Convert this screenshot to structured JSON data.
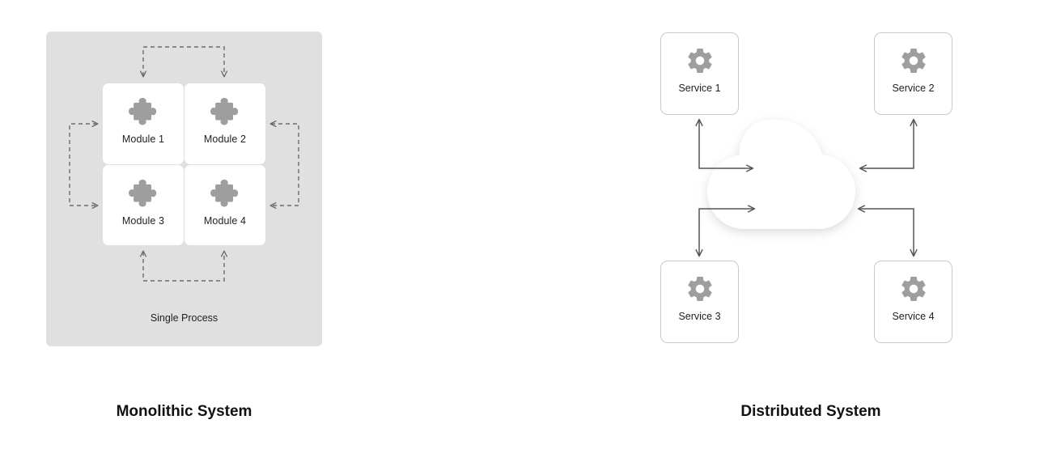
{
  "diagram": {
    "title_left": "Monolithic System",
    "title_right": "Distributed System",
    "background_color": "#ffffff"
  },
  "monolith": {
    "panel_label": "Single Process",
    "panel_color": "#e0e0e0",
    "card_color": "#ffffff",
    "icon_color": "#9e9e9e",
    "connector_style": "dashed",
    "connector_color": "#6b6b6b",
    "icon_name": "puzzle-piece-icon",
    "modules": [
      {
        "label": "Module 1"
      },
      {
        "label": "Module 2"
      },
      {
        "label": "Module 3"
      },
      {
        "label": "Module 4"
      }
    ],
    "connectors": [
      {
        "name": "top-bracket",
        "arrows": "down-down"
      },
      {
        "name": "left-bracket",
        "arrows": "right-right"
      },
      {
        "name": "right-bracket",
        "arrows": "left-left"
      },
      {
        "name": "bottom-bracket",
        "arrows": "up-up"
      }
    ]
  },
  "distributed": {
    "cloud_label": "",
    "cloud_color": "#ffffff",
    "card_border_color": "#c9c9c9",
    "icon_color": "#9e9e9e",
    "connector_style": "solid",
    "connector_color": "#555555",
    "icon_name": "gear-icon",
    "services": [
      {
        "label": "Service 1"
      },
      {
        "label": "Service 2"
      },
      {
        "label": "Service 3"
      },
      {
        "label": "Service 4"
      }
    ],
    "connectors": [
      {
        "name": "service-1-to-cloud",
        "arrows": "up-and-right"
      },
      {
        "name": "service-2-to-cloud",
        "arrows": "up-and-left"
      },
      {
        "name": "service-3-to-cloud",
        "arrows": "down-and-right"
      },
      {
        "name": "service-4-to-cloud",
        "arrows": "down-and-left"
      }
    ]
  }
}
